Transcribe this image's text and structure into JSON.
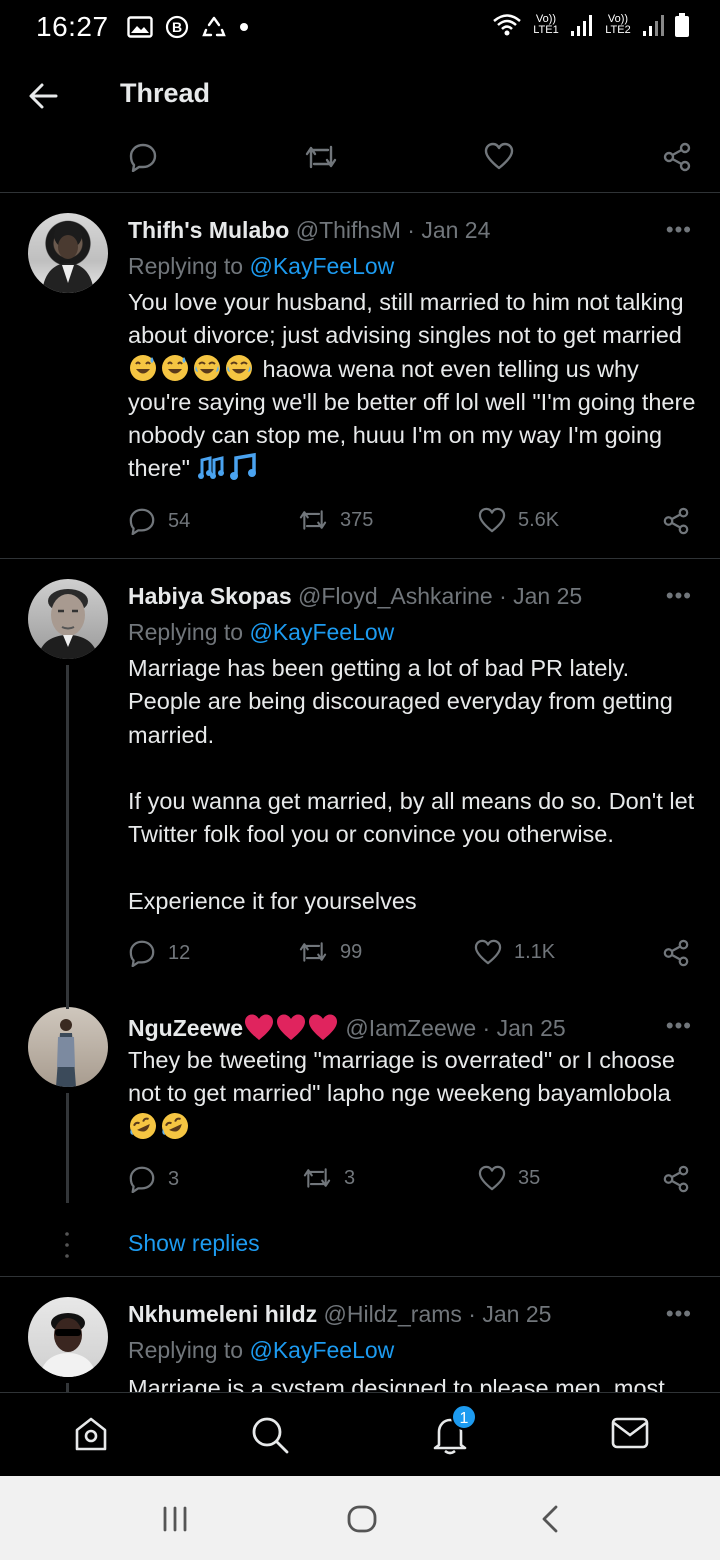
{
  "status_bar": {
    "time": "16:27",
    "sim1_label": "Vo)) LTE1",
    "sim2_label": "Vo)) LTE2",
    "icons": [
      "gallery-icon",
      "b-icon",
      "recycle-icon",
      "dot-icon",
      "wifi-icon",
      "signal-icon",
      "battery-icon"
    ]
  },
  "header": {
    "title": "Thread",
    "back_icon": "arrow-left-icon"
  },
  "tweets": [
    {
      "name": "Thifh's Mulabo",
      "handle": "@ThifhsM",
      "date": "· Jan 24",
      "replying_prefix": "Replying to ",
      "replying_handle": "@KayFeeLow",
      "text_1": "You love your husband, still married to him not talking about divorce; just advising singles not to get married ",
      "text_2": " haowa wena not even telling us why you're saying we'll be better off lol well \"I'm going there nobody can stop me, huuu I'm on my way I'm going there\" ",
      "replies": "54",
      "retweets": "375",
      "likes": "5.6K"
    },
    {
      "name": "Habiya Skopas",
      "handle": "@Floyd_Ashkarine",
      "date": "· Jan 25",
      "replying_prefix": "Replying to ",
      "replying_handle": "@KayFeeLow",
      "text": "Marriage has been getting a lot of bad PR lately. People are being discouraged everyday from getting married.\n\nIf you wanna get married, by all means do so. Don't let Twitter folk fool you or convince you otherwise.\n\nExperience it for yourselves",
      "replies": "12",
      "retweets": "99",
      "likes": "1.1K"
    },
    {
      "name": "NguZeewe",
      "handle": "@IamZeewe",
      "date": "· Jan 25",
      "text": "They be tweeting \"marriage is overrated\" or I choose not to get married\" lapho nge weekeng bayamlobola",
      "replies": "3",
      "retweets": "3",
      "likes": "35"
    },
    {
      "name": "Nkhumeleni hildz",
      "handle": "@Hildz_rams",
      "date": "· Jan 25",
      "replying_prefix": "Replying to ",
      "replying_handle": "@KayFeeLow",
      "text": "Marriage is a system designed to please men, most"
    }
  ],
  "show_replies": "Show replies",
  "more_label": "•••",
  "bottom_nav": {
    "items": [
      "home-icon",
      "search-icon",
      "notifications-icon",
      "messages-icon"
    ],
    "notification_count": "1"
  },
  "system_nav": [
    "recents-icon",
    "home-circle-icon",
    "back-chevron-icon"
  ],
  "colors": {
    "background": "#000000",
    "accent": "#1d9bf0",
    "muted": "#71767b",
    "heart": "#e0245e"
  }
}
